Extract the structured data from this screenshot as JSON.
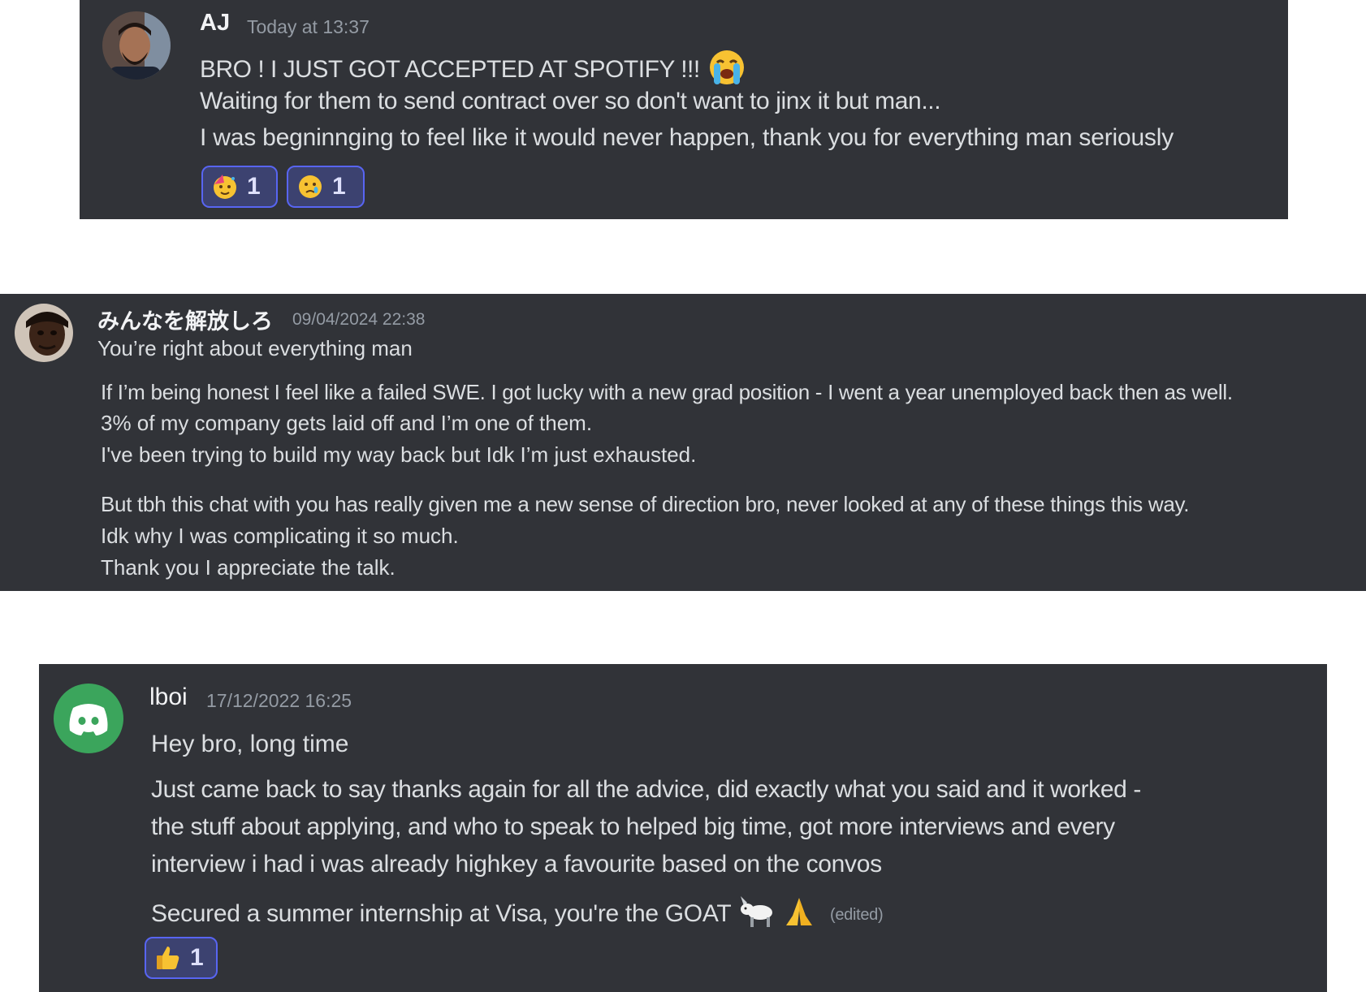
{
  "messages": [
    {
      "author": "AJ",
      "timestamp": "Today at 13:37",
      "avatar_icon": "user-avatar-photo",
      "lines": [
        "BRO ! I JUST GOT ACCEPTED AT SPOTIFY !!!",
        "Waiting for them to send contract over so don't want to jinx it but man...",
        "I was begninnging to feel like it would never happen, thank you for everything man seriously"
      ],
      "inline_emoji": "loudly-crying-face-emoji",
      "reactions": [
        {
          "emoji": "partying-face-icon",
          "count": "1"
        },
        {
          "emoji": "crying-face-icon",
          "count": "1"
        }
      ]
    },
    {
      "author": "みんなを解放しろ",
      "timestamp": "09/04/2024 22:38",
      "avatar_icon": "user-avatar-photo",
      "lines": [
        "You’re right about everything man",
        "If I’m being honest I feel like a failed SWE. I got lucky with a new grad position - I went a year unemployed back then as well.",
        "3% of my company gets laid off and I’m one of them.",
        "I've been trying to build my way back but Idk I’m just exhausted.",
        "But tbh this chat with you has really given me a new sense of direction bro, never looked at any of these things this way.",
        "Idk why I was complicating it so much.",
        "Thank you I appreciate the talk."
      ]
    },
    {
      "author": "lboi",
      "timestamp": "17/12/2022 16:25",
      "avatar_icon": "discord-logo-icon",
      "lines": [
        "Hey bro, long time",
        "Just came back to say thanks again for all the advice, did exactly what you said and it worked -",
        "the stuff about applying, and who to speak to helped big time, got more interviews and every",
        "interview i had i was already highkey a favourite based on the convos",
        "Secured a summer internship at Visa, you're the GOAT"
      ],
      "inline_emojis": [
        "goat-emoji",
        "folded-hands-emoji"
      ],
      "edited_label": "(edited)",
      "reactions": [
        {
          "emoji": "thumbs-up-icon",
          "count": "1"
        }
      ]
    }
  ],
  "colors": {
    "card_bg": "#313338",
    "text": "#dbdee1",
    "muted": "#949ba4",
    "reaction_border": "#5865f2",
    "reaction_bg": "#3c4270",
    "discord_green": "#3ba55c"
  }
}
